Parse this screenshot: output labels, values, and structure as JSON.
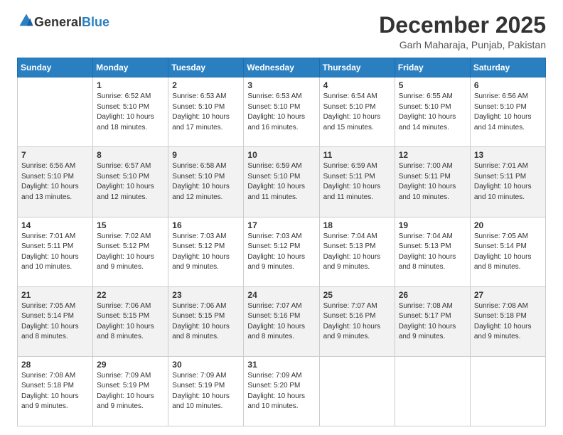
{
  "header": {
    "logo_general": "General",
    "logo_blue": "Blue",
    "month_title": "December 2025",
    "location": "Garh Maharaja, Punjab, Pakistan"
  },
  "days_of_week": [
    "Sunday",
    "Monday",
    "Tuesday",
    "Wednesday",
    "Thursday",
    "Friday",
    "Saturday"
  ],
  "weeks": [
    [
      {
        "day": "",
        "info": ""
      },
      {
        "day": "1",
        "info": "Sunrise: 6:52 AM\nSunset: 5:10 PM\nDaylight: 10 hours\nand 18 minutes."
      },
      {
        "day": "2",
        "info": "Sunrise: 6:53 AM\nSunset: 5:10 PM\nDaylight: 10 hours\nand 17 minutes."
      },
      {
        "day": "3",
        "info": "Sunrise: 6:53 AM\nSunset: 5:10 PM\nDaylight: 10 hours\nand 16 minutes."
      },
      {
        "day": "4",
        "info": "Sunrise: 6:54 AM\nSunset: 5:10 PM\nDaylight: 10 hours\nand 15 minutes."
      },
      {
        "day": "5",
        "info": "Sunrise: 6:55 AM\nSunset: 5:10 PM\nDaylight: 10 hours\nand 14 minutes."
      },
      {
        "day": "6",
        "info": "Sunrise: 6:56 AM\nSunset: 5:10 PM\nDaylight: 10 hours\nand 14 minutes."
      }
    ],
    [
      {
        "day": "7",
        "info": "Sunrise: 6:56 AM\nSunset: 5:10 PM\nDaylight: 10 hours\nand 13 minutes."
      },
      {
        "day": "8",
        "info": "Sunrise: 6:57 AM\nSunset: 5:10 PM\nDaylight: 10 hours\nand 12 minutes."
      },
      {
        "day": "9",
        "info": "Sunrise: 6:58 AM\nSunset: 5:10 PM\nDaylight: 10 hours\nand 12 minutes."
      },
      {
        "day": "10",
        "info": "Sunrise: 6:59 AM\nSunset: 5:10 PM\nDaylight: 10 hours\nand 11 minutes."
      },
      {
        "day": "11",
        "info": "Sunrise: 6:59 AM\nSunset: 5:11 PM\nDaylight: 10 hours\nand 11 minutes."
      },
      {
        "day": "12",
        "info": "Sunrise: 7:00 AM\nSunset: 5:11 PM\nDaylight: 10 hours\nand 10 minutes."
      },
      {
        "day": "13",
        "info": "Sunrise: 7:01 AM\nSunset: 5:11 PM\nDaylight: 10 hours\nand 10 minutes."
      }
    ],
    [
      {
        "day": "14",
        "info": "Sunrise: 7:01 AM\nSunset: 5:11 PM\nDaylight: 10 hours\nand 10 minutes."
      },
      {
        "day": "15",
        "info": "Sunrise: 7:02 AM\nSunset: 5:12 PM\nDaylight: 10 hours\nand 9 minutes."
      },
      {
        "day": "16",
        "info": "Sunrise: 7:03 AM\nSunset: 5:12 PM\nDaylight: 10 hours\nand 9 minutes."
      },
      {
        "day": "17",
        "info": "Sunrise: 7:03 AM\nSunset: 5:12 PM\nDaylight: 10 hours\nand 9 minutes."
      },
      {
        "day": "18",
        "info": "Sunrise: 7:04 AM\nSunset: 5:13 PM\nDaylight: 10 hours\nand 9 minutes."
      },
      {
        "day": "19",
        "info": "Sunrise: 7:04 AM\nSunset: 5:13 PM\nDaylight: 10 hours\nand 8 minutes."
      },
      {
        "day": "20",
        "info": "Sunrise: 7:05 AM\nSunset: 5:14 PM\nDaylight: 10 hours\nand 8 minutes."
      }
    ],
    [
      {
        "day": "21",
        "info": "Sunrise: 7:05 AM\nSunset: 5:14 PM\nDaylight: 10 hours\nand 8 minutes."
      },
      {
        "day": "22",
        "info": "Sunrise: 7:06 AM\nSunset: 5:15 PM\nDaylight: 10 hours\nand 8 minutes."
      },
      {
        "day": "23",
        "info": "Sunrise: 7:06 AM\nSunset: 5:15 PM\nDaylight: 10 hours\nand 8 minutes."
      },
      {
        "day": "24",
        "info": "Sunrise: 7:07 AM\nSunset: 5:16 PM\nDaylight: 10 hours\nand 8 minutes."
      },
      {
        "day": "25",
        "info": "Sunrise: 7:07 AM\nSunset: 5:16 PM\nDaylight: 10 hours\nand 9 minutes."
      },
      {
        "day": "26",
        "info": "Sunrise: 7:08 AM\nSunset: 5:17 PM\nDaylight: 10 hours\nand 9 minutes."
      },
      {
        "day": "27",
        "info": "Sunrise: 7:08 AM\nSunset: 5:18 PM\nDaylight: 10 hours\nand 9 minutes."
      }
    ],
    [
      {
        "day": "28",
        "info": "Sunrise: 7:08 AM\nSunset: 5:18 PM\nDaylight: 10 hours\nand 9 minutes."
      },
      {
        "day": "29",
        "info": "Sunrise: 7:09 AM\nSunset: 5:19 PM\nDaylight: 10 hours\nand 9 minutes."
      },
      {
        "day": "30",
        "info": "Sunrise: 7:09 AM\nSunset: 5:19 PM\nDaylight: 10 hours\nand 10 minutes."
      },
      {
        "day": "31",
        "info": "Sunrise: 7:09 AM\nSunset: 5:20 PM\nDaylight: 10 hours\nand 10 minutes."
      },
      {
        "day": "",
        "info": ""
      },
      {
        "day": "",
        "info": ""
      },
      {
        "day": "",
        "info": ""
      }
    ]
  ]
}
